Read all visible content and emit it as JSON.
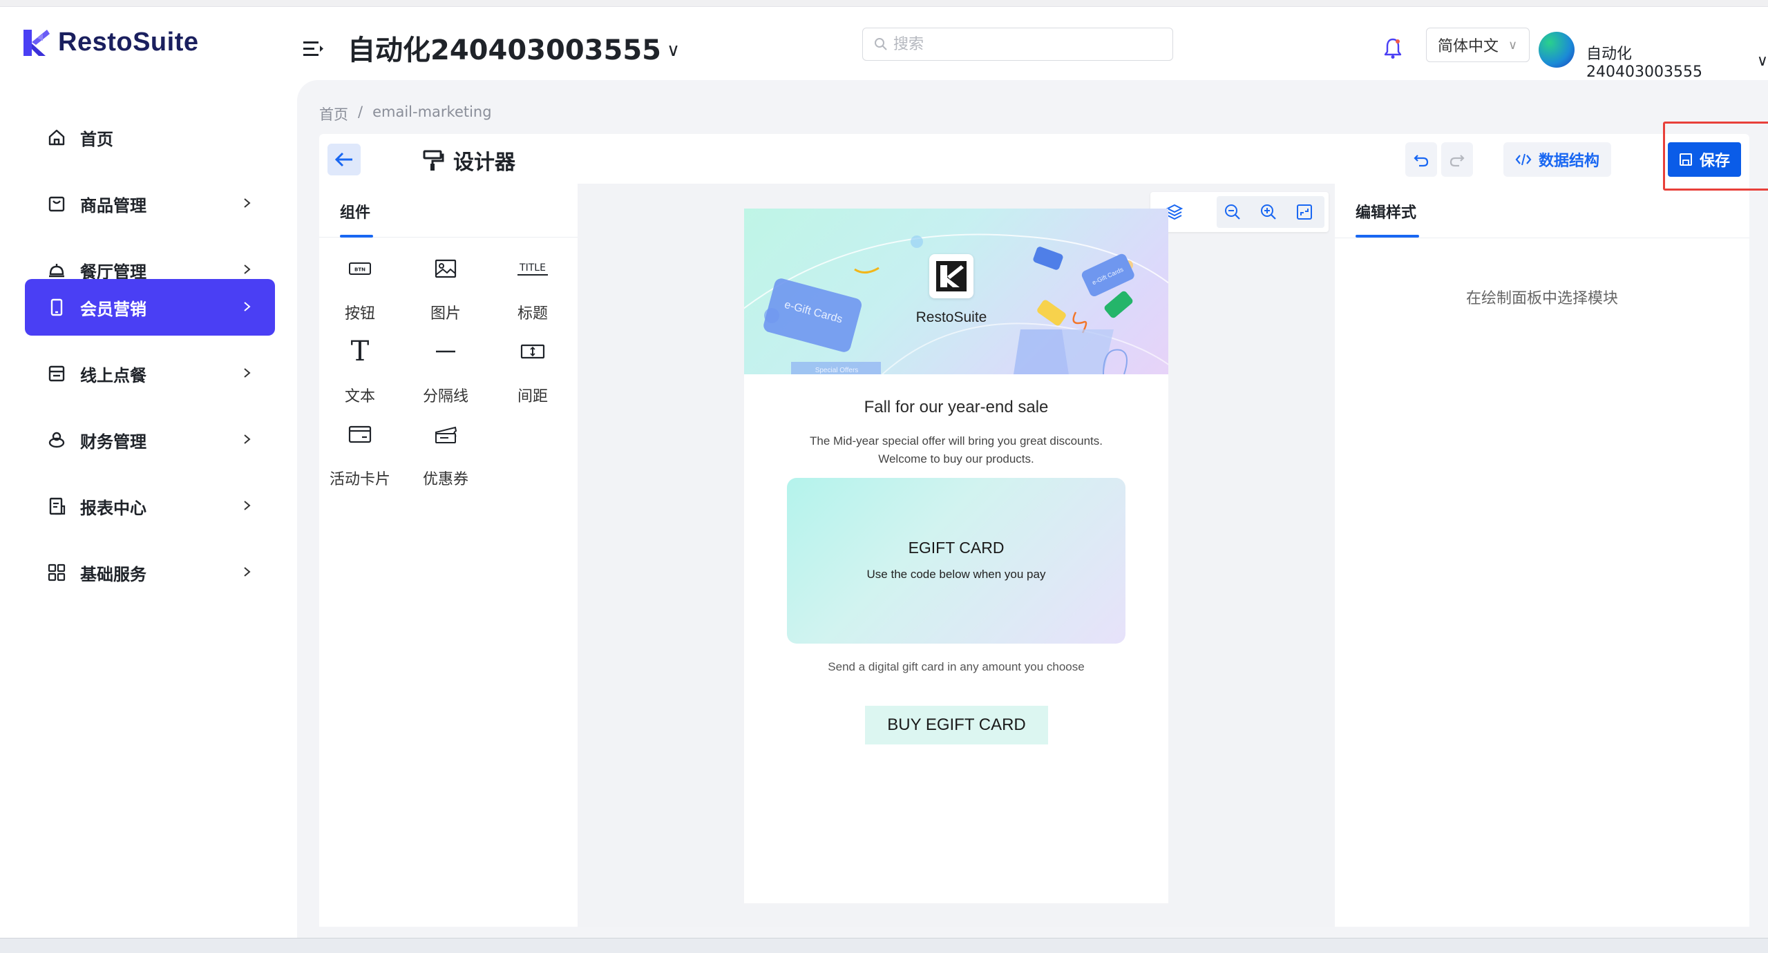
{
  "app": {
    "logo_text": "RestoSuite",
    "store_name": "自动化240403003555",
    "search_placeholder": "搜索",
    "language": "简体中文",
    "username": "自动化240403003555"
  },
  "sidebar": {
    "items": [
      {
        "label": "首页",
        "icon": "home-icon",
        "active": false
      },
      {
        "label": "商品管理",
        "icon": "product-bag-icon",
        "active": false
      },
      {
        "label": "餐厅管理",
        "icon": "restaurant-bell-icon",
        "active": false
      },
      {
        "label": "会员营销",
        "icon": "mobile-phone-icon",
        "active": true
      },
      {
        "label": "线上点餐",
        "icon": "online-order-icon",
        "active": false
      },
      {
        "label": "财务管理",
        "icon": "finance-icon",
        "active": false
      },
      {
        "label": "报表中心",
        "icon": "report-icon",
        "active": false
      },
      {
        "label": "基础服务",
        "icon": "grid-apps-icon",
        "active": false
      }
    ]
  },
  "breadcrumb": {
    "home": "首页",
    "separator": "/",
    "current": "email-marketing"
  },
  "designer": {
    "title": "设计器",
    "data_structure_label": "数据结构",
    "save_label": "保存",
    "components_tab": "组件",
    "components": [
      {
        "label": "按钮",
        "icon": "button-icon"
      },
      {
        "label": "图片",
        "icon": "image-icon"
      },
      {
        "label": "标题",
        "icon": "title-icon"
      },
      {
        "label": "文本",
        "icon": "text-icon"
      },
      {
        "label": "分隔线",
        "icon": "divider-icon"
      },
      {
        "label": "间距",
        "icon": "spacing-icon"
      },
      {
        "label": "活动卡片",
        "icon": "activity-card-icon"
      },
      {
        "label": "优惠券",
        "icon": "coupon-icon"
      }
    ],
    "style_tab": "编辑样式",
    "style_empty": "在绘制面板中选择模块"
  },
  "email": {
    "hero_brand": "RestoSuite",
    "hero_card_left": "e-Gift Cards",
    "hero_card_left_sub": "Special Offers",
    "hero_card_right": "e-Gift Cards",
    "title": "Fall for our year-end sale",
    "subtitle_line1": "The Mid-year special offer will bring you great discounts.",
    "subtitle_line2": "Welcome to buy our products.",
    "gift_title": "EGIFT CARD",
    "gift_sub": "Use the code below when you pay",
    "note": "Send a digital gift card in any amount you choose",
    "button": "BUY EGIFT CARD"
  },
  "colors": {
    "brand_primary": "#4a3ff4",
    "accent_blue": "#1967f2",
    "save_button": "#0a5ce8",
    "highlight_red": "#e8403a"
  }
}
